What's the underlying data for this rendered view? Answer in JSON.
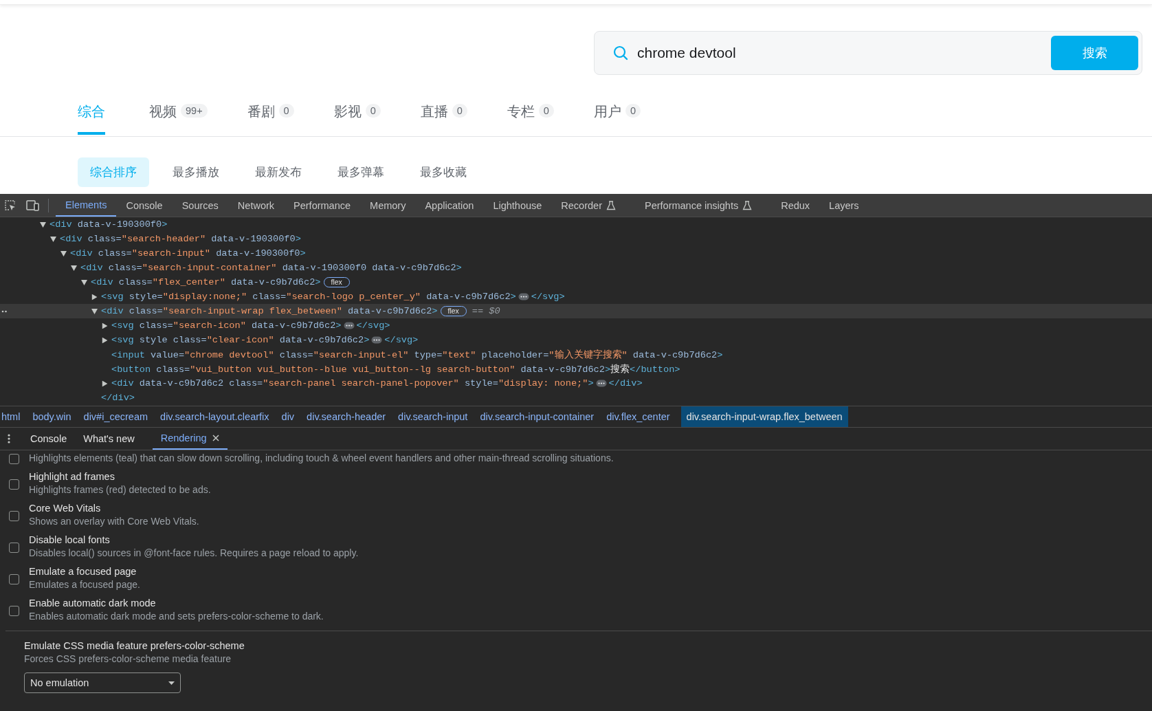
{
  "page": {
    "search": {
      "value": "chrome devtool",
      "button": "搜索"
    },
    "tabs": [
      {
        "label": "综合",
        "selected": true
      },
      {
        "label": "视频",
        "count": "99+",
        "selected": false
      },
      {
        "label": "番剧",
        "count": "0",
        "selected": false
      },
      {
        "label": "影视",
        "count": "0",
        "selected": false
      },
      {
        "label": "直播",
        "count": "0",
        "selected": false
      },
      {
        "label": "专栏",
        "count": "0",
        "selected": false
      },
      {
        "label": "用户",
        "count": "0",
        "selected": false
      }
    ],
    "sort_options": [
      {
        "label": "综合排序",
        "selected": true
      },
      {
        "label": "最多播放",
        "selected": false
      },
      {
        "label": "最新发布",
        "selected": false
      },
      {
        "label": "最多弹幕",
        "selected": false
      },
      {
        "label": "最多收藏",
        "selected": false
      }
    ]
  },
  "devtools": {
    "tabs": [
      {
        "label": "Elements",
        "selected": true,
        "experimental": false
      },
      {
        "label": "Console",
        "selected": false,
        "experimental": false
      },
      {
        "label": "Sources",
        "selected": false,
        "experimental": false
      },
      {
        "label": "Network",
        "selected": false,
        "experimental": false
      },
      {
        "label": "Performance",
        "selected": false,
        "experimental": false
      },
      {
        "label": "Memory",
        "selected": false,
        "experimental": false
      },
      {
        "label": "Application",
        "selected": false,
        "experimental": false
      },
      {
        "label": "Lighthouse",
        "selected": false,
        "experimental": false
      },
      {
        "label": "Recorder",
        "selected": false,
        "experimental": true
      },
      {
        "label": "Performance insights",
        "selected": false,
        "experimental": true
      },
      {
        "label": "Redux",
        "selected": false,
        "experimental": false
      },
      {
        "label": "Layers",
        "selected": false,
        "experimental": false
      }
    ],
    "elements": {
      "nodes": [
        {
          "kind": "expandable",
          "expanded": true,
          "selected": false,
          "segments": [
            {
              "kind": "tag",
              "text": "<div"
            },
            {
              "kind": "attr",
              "text": " data-v-190300f0"
            },
            {
              "kind": "tag",
              "text": ">"
            }
          ],
          "children": [
            {
              "kind": "expandable",
              "expanded": true,
              "selected": false,
              "segments": [
                {
                  "kind": "tag",
                  "text": "<div"
                },
                {
                  "kind": "attr",
                  "text": " class="
                },
                {
                  "kind": "val",
                  "text": "\"search-header\""
                },
                {
                  "kind": "attr",
                  "text": " data-v-190300f0"
                },
                {
                  "kind": "tag",
                  "text": ">"
                }
              ],
              "children": [
                {
                  "kind": "expandable",
                  "expanded": true,
                  "selected": false,
                  "segments": [
                    {
                      "kind": "tag",
                      "text": "<div"
                    },
                    {
                      "kind": "attr",
                      "text": " class="
                    },
                    {
                      "kind": "val",
                      "text": "\"search-input\""
                    },
                    {
                      "kind": "attr",
                      "text": " data-v-190300f0"
                    },
                    {
                      "kind": "tag",
                      "text": ">"
                    }
                  ],
                  "children": [
                    {
                      "kind": "expandable",
                      "expanded": true,
                      "selected": false,
                      "segments": [
                        {
                          "kind": "tag",
                          "text": "<div"
                        },
                        {
                          "kind": "attr",
                          "text": " class="
                        },
                        {
                          "kind": "val",
                          "text": "\"search-input-container\""
                        },
                        {
                          "kind": "attr",
                          "text": " data-v-190300f0 data-v-c9b7d6c2"
                        },
                        {
                          "kind": "tag",
                          "text": ">"
                        }
                      ],
                      "children": [
                        {
                          "kind": "expandable",
                          "expanded": true,
                          "selected": false,
                          "segments": [
                            {
                              "kind": "tag",
                              "text": "<div"
                            },
                            {
                              "kind": "attr",
                              "text": " class="
                            },
                            {
                              "kind": "val",
                              "text": "\"flex_center\""
                            },
                            {
                              "kind": "attr",
                              "text": " data-v-c9b7d6c2"
                            },
                            {
                              "kind": "tag",
                              "text": ">"
                            },
                            {
                              "kind": "badge",
                              "text": "flex"
                            }
                          ],
                          "children": [
                            {
                              "kind": "expandable",
                              "expanded": false,
                              "selected": false,
                              "segments": [
                                {
                                  "kind": "tag",
                                  "text": "<svg"
                                },
                                {
                                  "kind": "attr",
                                  "text": " style="
                                },
                                {
                                  "kind": "val",
                                  "text": "\"display:none;\""
                                },
                                {
                                  "kind": "attr",
                                  "text": " class="
                                },
                                {
                                  "kind": "val",
                                  "text": "\"search-logo p_center_y\""
                                },
                                {
                                  "kind": "attr",
                                  "text": " data-v-c9b7d6c2"
                                },
                                {
                                  "kind": "tag",
                                  "text": ">"
                                },
                                {
                                  "kind": "dots"
                                },
                                {
                                  "kind": "tag",
                                  "text": "</svg>"
                                }
                              ]
                            },
                            {
                              "kind": "expandable",
                              "expanded": true,
                              "selected": true,
                              "segments": [
                                {
                                  "kind": "tag",
                                  "text": "<div"
                                },
                                {
                                  "kind": "attr",
                                  "text": " class="
                                },
                                {
                                  "kind": "val",
                                  "text": "\"search-input-wrap flex_between\""
                                },
                                {
                                  "kind": "attr",
                                  "text": " data-v-c9b7d6c2"
                                },
                                {
                                  "kind": "tag",
                                  "text": ">"
                                },
                                {
                                  "kind": "badge",
                                  "text": "flex"
                                },
                                {
                                  "kind": "ref",
                                  "text": "== $0"
                                }
                              ],
                              "close": "</div>",
                              "children": [
                                {
                                  "kind": "expandable",
                                  "expanded": false,
                                  "selected": false,
                                  "segments": [
                                    {
                                      "kind": "tag",
                                      "text": "<svg"
                                    },
                                    {
                                      "kind": "attr",
                                      "text": " class="
                                    },
                                    {
                                      "kind": "val",
                                      "text": "\"search-icon\""
                                    },
                                    {
                                      "kind": "attr",
                                      "text": " data-v-c9b7d6c2"
                                    },
                                    {
                                      "kind": "tag",
                                      "text": ">"
                                    },
                                    {
                                      "kind": "dots"
                                    },
                                    {
                                      "kind": "tag",
                                      "text": "</svg>"
                                    }
                                  ]
                                },
                                {
                                  "kind": "expandable",
                                  "expanded": false,
                                  "selected": false,
                                  "segments": [
                                    {
                                      "kind": "tag",
                                      "text": "<svg"
                                    },
                                    {
                                      "kind": "attr",
                                      "text": " style class="
                                    },
                                    {
                                      "kind": "val",
                                      "text": "\"clear-icon\""
                                    },
                                    {
                                      "kind": "attr",
                                      "text": " data-v-c9b7d6c2"
                                    },
                                    {
                                      "kind": "tag",
                                      "text": ">"
                                    },
                                    {
                                      "kind": "dots"
                                    },
                                    {
                                      "kind": "tag",
                                      "text": "</svg>"
                                    }
                                  ]
                                },
                                {
                                  "kind": "leaf",
                                  "selected": false,
                                  "segments": [
                                    {
                                      "kind": "tag",
                                      "text": "<input"
                                    },
                                    {
                                      "kind": "attr",
                                      "text": " value="
                                    },
                                    {
                                      "kind": "val",
                                      "text": "\"chrome devtool\""
                                    },
                                    {
                                      "kind": "attr",
                                      "text": " class="
                                    },
                                    {
                                      "kind": "val",
                                      "text": "\"search-input-el\""
                                    },
                                    {
                                      "kind": "attr",
                                      "text": " type="
                                    },
                                    {
                                      "kind": "val",
                                      "text": "\"text\""
                                    },
                                    {
                                      "kind": "attr",
                                      "text": " placeholder="
                                    },
                                    {
                                      "kind": "val",
                                      "text": "\"输入关键字搜索\""
                                    },
                                    {
                                      "kind": "attr",
                                      "text": " data-v-c9b7d6c2"
                                    },
                                    {
                                      "kind": "tag",
                                      "text": ">"
                                    }
                                  ]
                                },
                                {
                                  "kind": "leaf",
                                  "selected": false,
                                  "segments": [
                                    {
                                      "kind": "tag",
                                      "text": "<button"
                                    },
                                    {
                                      "kind": "attr",
                                      "text": " class="
                                    },
                                    {
                                      "kind": "val",
                                      "text": "\"vui_button vui_button--blue vui_button--lg search-button\""
                                    },
                                    {
                                      "kind": "attr",
                                      "text": " data-v-c9b7d6c2"
                                    },
                                    {
                                      "kind": "tag",
                                      "text": ">"
                                    },
                                    {
                                      "kind": "txt",
                                      "text": "搜索"
                                    },
                                    {
                                      "kind": "tag",
                                      "text": "</button>"
                                    }
                                  ]
                                },
                                {
                                  "kind": "expandable",
                                  "expanded": false,
                                  "selected": false,
                                  "segments": [
                                    {
                                      "kind": "tag",
                                      "text": "<div"
                                    },
                                    {
                                      "kind": "attr",
                                      "text": " data-v-c9b7d6c2 class="
                                    },
                                    {
                                      "kind": "val",
                                      "text": "\"search-panel search-panel-popover\""
                                    },
                                    {
                                      "kind": "attr",
                                      "text": " style="
                                    },
                                    {
                                      "kind": "val",
                                      "text": "\"display: none;\""
                                    },
                                    {
                                      "kind": "tag",
                                      "text": ">"
                                    },
                                    {
                                      "kind": "dots"
                                    },
                                    {
                                      "kind": "tag",
                                      "text": "</div>"
                                    }
                                  ]
                                }
                              ]
                            }
                          ]
                        }
                      ]
                    }
                  ]
                }
              ]
            }
          ]
        }
      ]
    },
    "breadcrumbs": [
      {
        "label": "html",
        "selected": false
      },
      {
        "label": "body.win",
        "selected": false
      },
      {
        "label": "div#i_cecream",
        "selected": false
      },
      {
        "label": "div.search-layout.clearfix",
        "selected": false
      },
      {
        "label": "div",
        "selected": false
      },
      {
        "label": "div.search-header",
        "selected": false
      },
      {
        "label": "div.search-input",
        "selected": false
      },
      {
        "label": "div.search-input-container",
        "selected": false
      },
      {
        "label": "div.flex_center",
        "selected": false
      },
      {
        "label": "div.search-input-wrap.flex_between",
        "selected": true
      }
    ],
    "drawer_tabs": [
      {
        "label": "Console",
        "selected": false,
        "closable": false
      },
      {
        "label": "What's new",
        "selected": false,
        "closable": false
      },
      {
        "label": "Rendering",
        "selected": true,
        "closable": true
      }
    ],
    "rendering": {
      "options": [
        {
          "description": "Highlights elements (teal) that can slow down scrolling, including touch & wheel event handlers and other main-thread scrolling situations.",
          "checked": false
        },
        {
          "title": "Highlight ad frames",
          "description": "Highlights frames (red) detected to be ads.",
          "checked": false
        },
        {
          "title": "Core Web Vitals",
          "description": "Shows an overlay with Core Web Vitals.",
          "checked": false
        },
        {
          "title": "Disable local fonts",
          "description": "Disables local() sources in @font-face rules. Requires a page reload to apply.",
          "checked": false
        },
        {
          "title": "Emulate a focused page",
          "description": "Emulates a focused page.",
          "checked": false
        },
        {
          "title": "Enable automatic dark mode",
          "description": "Enables automatic dark mode and sets prefers-color-scheme to dark.",
          "checked": false
        }
      ],
      "media_feature": {
        "title": "Emulate CSS media feature prefers-color-scheme",
        "description": "Forces CSS prefers-color-scheme media feature",
        "select": "No emulation"
      }
    }
  }
}
